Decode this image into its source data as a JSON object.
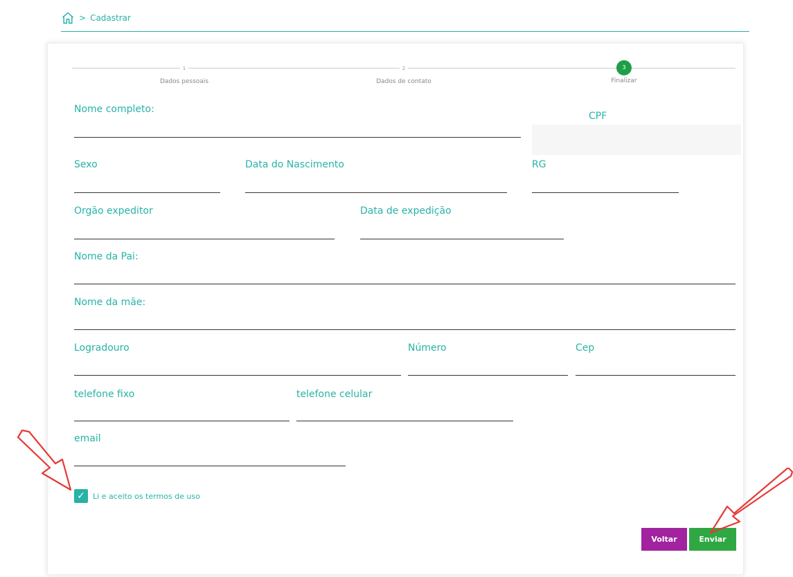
{
  "breadcrumb": {
    "current": "Cadastrar",
    "separator": ">"
  },
  "stepper": {
    "steps": [
      {
        "number": "1",
        "label": "Dados pessoais"
      },
      {
        "number": "2",
        "label": "Dados de contato"
      },
      {
        "number": "3",
        "label": "Finalizar"
      }
    ],
    "active_step": 3
  },
  "form": {
    "nome_completo": "Nome completo:",
    "cpf": "CPF",
    "sexo": "Sexo",
    "data_nascimento": "Data do Nascimento",
    "rg": "RG",
    "orgao_expeditor": "Orgão expeditor",
    "data_expedicao": "Data de expedição",
    "nome_pai": "Nome da Pai:",
    "nome_mae": "Nome da mãe:",
    "logradouro": "Logradouro",
    "numero": "Número",
    "cep": "Cep",
    "telefone_fixo": "telefone fixo",
    "telefone_celular": "telefone celular",
    "email": "email"
  },
  "terms": {
    "label": "Li e aceito os termos de uso",
    "checked": true
  },
  "buttons": {
    "back": "Voltar",
    "send": "Enviar"
  },
  "colors": {
    "accent": "#27b3a6",
    "step_active": "#1f9e4a",
    "back_button": "#a1239f",
    "send_button": "#2fa843",
    "annotation_arrow": "#e53935"
  }
}
